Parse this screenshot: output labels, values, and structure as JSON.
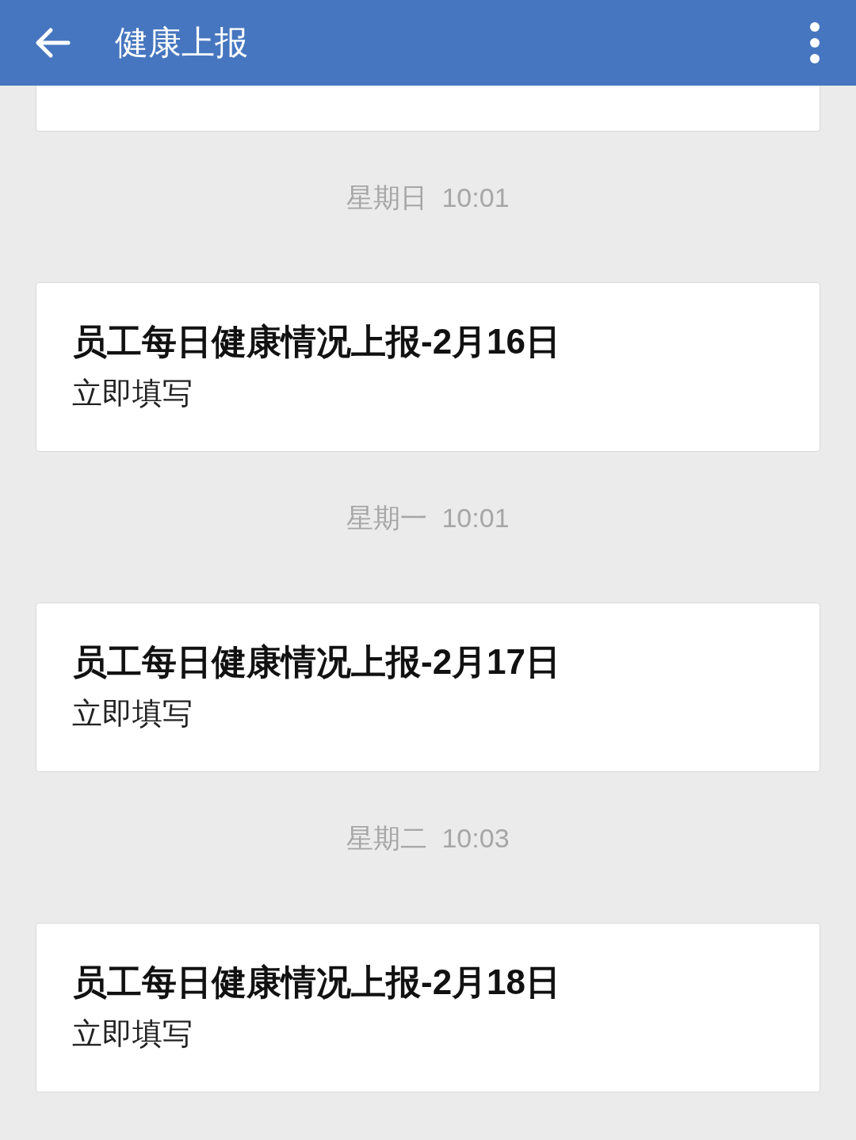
{
  "header": {
    "title": "健康上报"
  },
  "messages": [
    {
      "day": "星期日",
      "time": "10:01",
      "title": "员工每日健康情况上报-2月16日",
      "action": "立即填写"
    },
    {
      "day": "星期一",
      "time": "10:01",
      "title": "员工每日健康情况上报-2月17日",
      "action": "立即填写"
    },
    {
      "day": "星期二",
      "time": "10:03",
      "title": "员工每日健康情况上报-2月18日",
      "action": "立即填写"
    }
  ]
}
